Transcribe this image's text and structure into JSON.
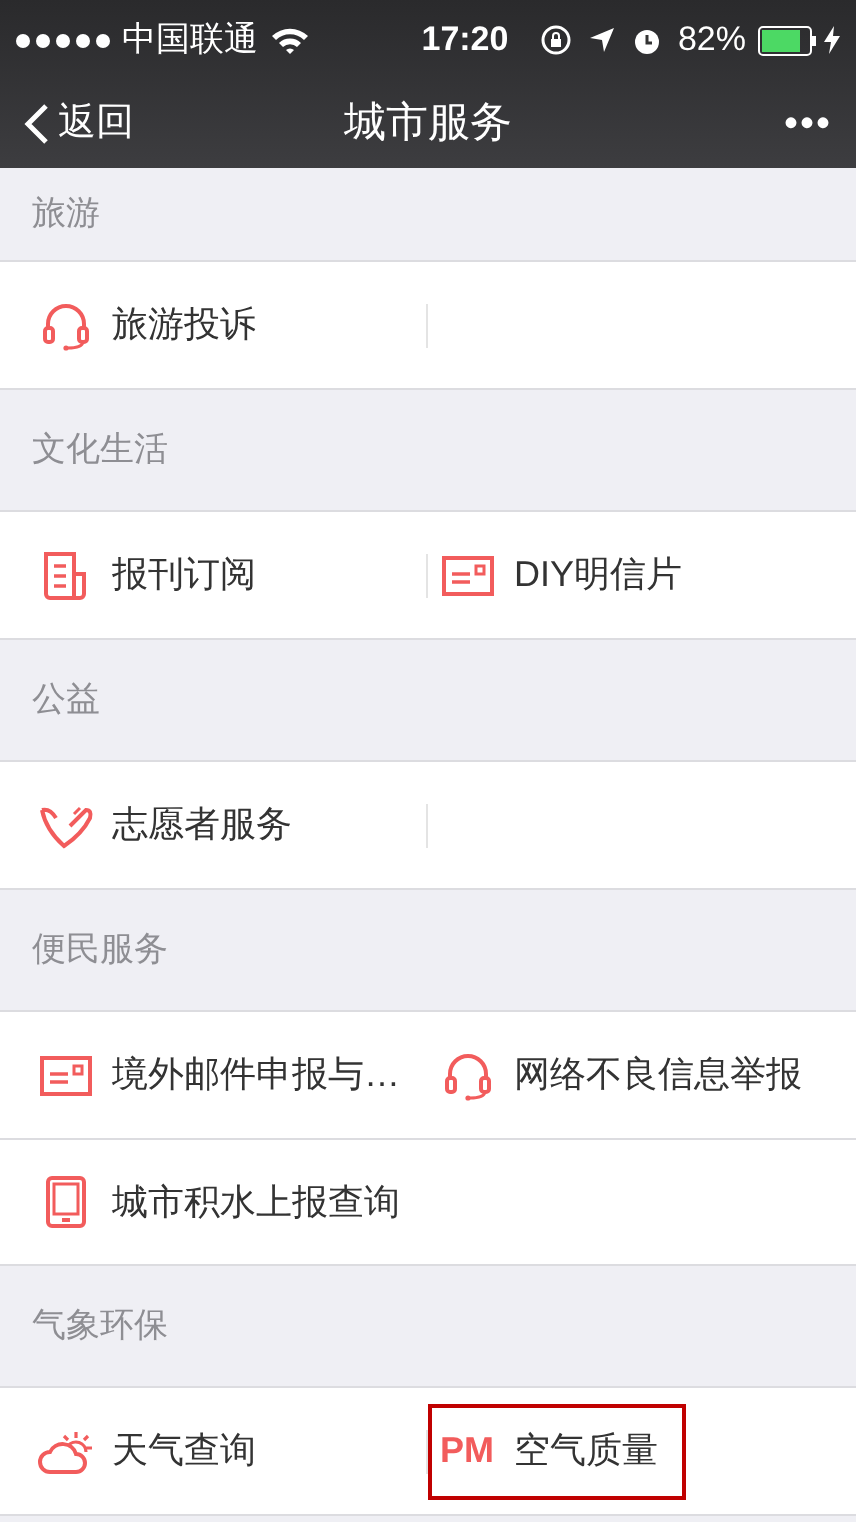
{
  "status_bar": {
    "carrier": "中国联通",
    "time": "17:20",
    "battery": "82%"
  },
  "nav": {
    "back": "返回",
    "title": "城市服务",
    "more": "•••"
  },
  "sections": [
    {
      "title": "旅游",
      "rows": [
        [
          {
            "label": "旅游投诉",
            "kind": "headset"
          }
        ]
      ]
    },
    {
      "title": "文化生活",
      "rows": [
        [
          {
            "label": "报刊订阅",
            "kind": "newspaper"
          },
          {
            "label": "DIY明信片",
            "kind": "card"
          }
        ]
      ]
    },
    {
      "title": "公益",
      "rows": [
        [
          {
            "label": "志愿者服务",
            "kind": "heart"
          }
        ]
      ]
    },
    {
      "title": "便民服务",
      "rows": [
        [
          {
            "label": "境外邮件申报与…",
            "kind": "card"
          },
          {
            "label": "网络不良信息举报",
            "kind": "headset"
          }
        ],
        [
          {
            "label": "城市积水上报查询",
            "kind": "tablet"
          }
        ]
      ]
    },
    {
      "title": "气象环保",
      "rows": [
        [
          {
            "label": "天气查询",
            "kind": "weather"
          },
          {
            "label": "空气质量",
            "kind": "pm",
            "icon_text": "PM",
            "highlighted": true
          }
        ]
      ]
    }
  ]
}
